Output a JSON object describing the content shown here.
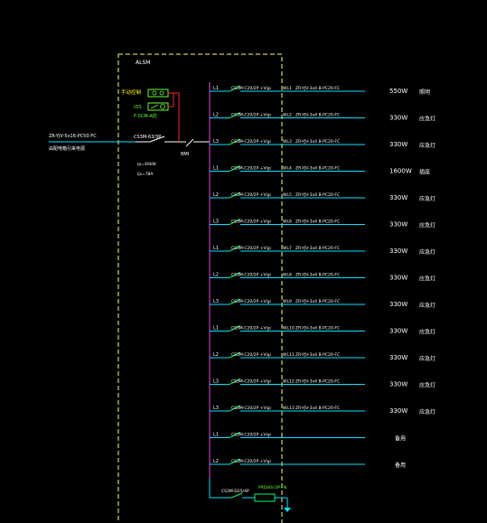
{
  "panel": {
    "label": "ALSM",
    "colors": {
      "frame": "#ffff66",
      "busbar": "#cc33cc",
      "feeder": "#00e5ff",
      "breaker": "#00ff66",
      "text_white": "#ffffff",
      "text_green": "#66ff33",
      "text_yellow": "#ffff00",
      "control": "#ff2222"
    }
  },
  "incoming": {
    "cable": "ZR-YJV-5x16-PC50-FC",
    "note": "由配电箱引来电源",
    "breaker": "CS3M-63/3P",
    "setting": "Ip=40kW",
    "current": "Ijs=78A",
    "switch_tag": "BMI"
  },
  "control": {
    "title": "手动控制",
    "line1": "IDS",
    "line2": "F-SCM-A控"
  },
  "circuits": [
    {
      "phase": "L1",
      "breaker": "CS3M-C20/2P +Vigi",
      "id": "WL1",
      "cable": "ZR-YJV-3x4 B-PC20-FC",
      "power": "550W",
      "use": "照明"
    },
    {
      "phase": "L2",
      "breaker": "CS3M-C20/2P +Vigi",
      "id": "WL2",
      "cable": "ZR-YJV-3x4 B-PC20-FC",
      "power": "330W",
      "use": "应急灯"
    },
    {
      "phase": "L3",
      "breaker": "CS3M-C20/2P +Vigi",
      "id": "WL3",
      "cable": "ZR-YJV-3x4 B-PC20-FC",
      "power": "330W",
      "use": "应急灯"
    },
    {
      "phase": "L1",
      "breaker": "CS3M-C20/2P +Vigi",
      "id": "WL4",
      "cable": "ZR-YJV-3x4 B-PC20-FC",
      "power": "1600W",
      "use": "插座"
    },
    {
      "phase": "L2",
      "breaker": "CS3M-C20/2P +Vigi",
      "id": "WL5",
      "cable": "ZR-YJV-3x4 B-PC20-FC",
      "power": "330W",
      "use": "应急灯"
    },
    {
      "phase": "L3",
      "breaker": "CS3M-C20/2P +Vigi",
      "id": "WL6",
      "cable": "ZR-YJV-3x4 B-PC20-FC",
      "power": "330W",
      "use": "应急灯"
    },
    {
      "phase": "L1",
      "breaker": "CS3M-C20/2P +Vigi",
      "id": "WL7",
      "cable": "ZR-YJV-3x4 B-PC20-FC",
      "power": "330W",
      "use": "应急灯"
    },
    {
      "phase": "L2",
      "breaker": "CS3M-C20/2P +Vigi",
      "id": "WL8",
      "cable": "ZR-YJV-3x4 B-PC20-FC",
      "power": "330W",
      "use": "应急灯"
    },
    {
      "phase": "L3",
      "breaker": "CS3M-C20/2P +Vigi",
      "id": "WL9",
      "cable": "ZR-YJV-3x4 B-PC20-FC",
      "power": "330W",
      "use": "应急灯"
    },
    {
      "phase": "L1",
      "breaker": "CS3M-C20/2P +Vigi",
      "id": "WL10",
      "cable": "ZR-YJV-3x4 B-PC20-FC",
      "power": "330W",
      "use": "应急灯"
    },
    {
      "phase": "L2",
      "breaker": "CS3M-C20/2P +Vigi",
      "id": "WL11",
      "cable": "ZR-YJV-3x4 B-PC20-FC",
      "power": "330W",
      "use": "应急灯"
    },
    {
      "phase": "L3",
      "breaker": "CS3M-C20/2P +Vigi",
      "id": "WL12",
      "cable": "ZR-YJV-3x4 B-PC20-FC",
      "power": "330W",
      "use": "应急灯"
    },
    {
      "phase": "L3",
      "breaker": "CS3M-C20/2P +Vigi",
      "id": "WL13",
      "cable": "ZR-YJV-3x4 B-PC20-FC",
      "power": "330W",
      "use": "应急灯"
    },
    {
      "phase": "L1",
      "breaker": "CS3M-C20/2P +Vigi",
      "id": "",
      "cable": "",
      "power": "",
      "use": "备用"
    },
    {
      "phase": "L2",
      "breaker": "CS3M-C20/2P +Vigi",
      "id": "",
      "cable": "",
      "power": "",
      "use": "备用"
    }
  ],
  "spd": {
    "breaker": "CS3M-D25/4P",
    "device": "PRD40r/3P+N"
  }
}
